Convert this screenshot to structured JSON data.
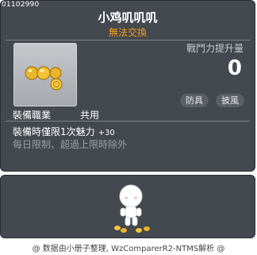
{
  "item": {
    "id": "01102990",
    "name": "小鸡叽叽叽",
    "trade_status": "無法交換",
    "icon": "gold-coins-icon",
    "power_label": "戰鬥力提升量",
    "power_value": "0",
    "tags": [
      "防具",
      "披風"
    ],
    "job_label": "裝備職業",
    "job_value": "共用",
    "effect_text": "裝備時僅限1次魅力",
    "effect_amount": "+30",
    "limit_text": "每日限制、超過上限時除外"
  },
  "preview": {
    "figure": "chick-character"
  },
  "footer": {
    "credit": "@ 数据由小册子整理, WzComparerR2-NTMS解析 @"
  },
  "colors": {
    "panel": "#44484f",
    "accent": "#f4a21c",
    "text": "#ffffff",
    "muted": "#9b9fa6"
  }
}
